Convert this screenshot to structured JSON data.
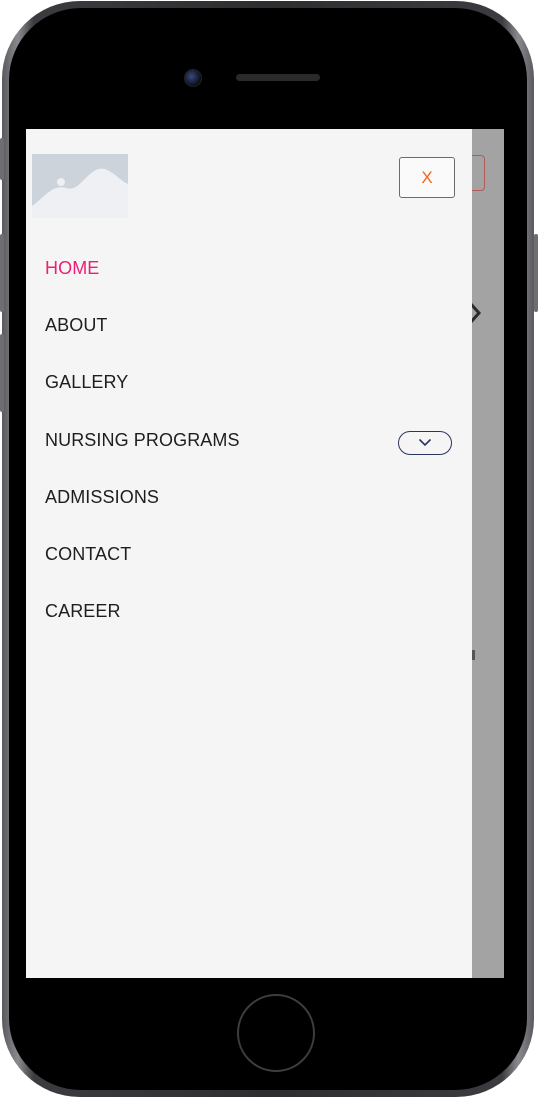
{
  "drawer": {
    "close_label": "X",
    "nav_items": [
      {
        "label": "HOME",
        "active": true
      },
      {
        "label": "ABOUT"
      },
      {
        "label": "GALLERY"
      },
      {
        "label": "NURSING PROGRAMS",
        "has_dropdown": true
      },
      {
        "label": "ADMISSIONS"
      },
      {
        "label": "CONTACT"
      },
      {
        "label": "CAREER"
      }
    ]
  },
  "colors": {
    "active_link": "#ee1e76",
    "close_text": "#f26522",
    "dropdown_border": "#2a3560",
    "drawer_bg": "#f5f5f5",
    "overlay": "#a3a3a3"
  },
  "icons": {
    "logo": "image-placeholder-icon",
    "dropdown": "chevron-down-icon",
    "close": "close-icon"
  }
}
